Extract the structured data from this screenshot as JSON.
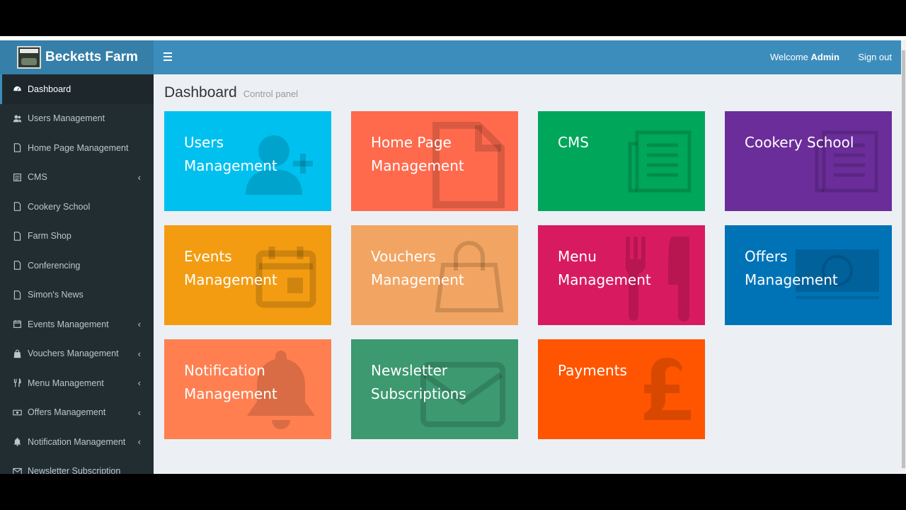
{
  "app": {
    "name": "Becketts Farm",
    "logo_icon": "farm-logo"
  },
  "header": {
    "welcome_prefix": "Welcome",
    "user": "Admin",
    "signout": "Sign out"
  },
  "sidebar": {
    "items": [
      {
        "label": "Dashboard",
        "icon": "dashboard-icon",
        "active": true,
        "submenu": false
      },
      {
        "label": "Users Management",
        "icon": "users-icon",
        "submenu": false
      },
      {
        "label": "Home Page Management",
        "icon": "file-icon",
        "submenu": false
      },
      {
        "label": "CMS",
        "icon": "list-icon",
        "submenu": true
      },
      {
        "label": "Cookery School",
        "icon": "file-icon",
        "submenu": false
      },
      {
        "label": "Farm Shop",
        "icon": "file-icon",
        "submenu": false
      },
      {
        "label": "Conferencing",
        "icon": "file-icon",
        "submenu": false
      },
      {
        "label": "Simon's News",
        "icon": "file-icon",
        "submenu": false
      },
      {
        "label": "Events Management",
        "icon": "calendar-icon",
        "submenu": true
      },
      {
        "label": "Vouchers Management",
        "icon": "shopping-bag-icon",
        "submenu": true
      },
      {
        "label": "Menu Management",
        "icon": "cutlery-icon",
        "submenu": true
      },
      {
        "label": "Offers Management",
        "icon": "money-icon",
        "submenu": true
      },
      {
        "label": "Notification Management",
        "icon": "bell-icon",
        "submenu": true
      },
      {
        "label": "Newsletter Subscription",
        "icon": "envelope-icon",
        "submenu": false
      }
    ],
    "chevron": "‹"
  },
  "main": {
    "title": "Dashboard",
    "subtitle": "Control panel",
    "tiles": [
      {
        "line1": "Users",
        "line2": "Management",
        "color": "#00c0ef",
        "icon": "user-plus-icon"
      },
      {
        "line1": "Home Page",
        "line2": "Management",
        "color": "#ff6a4d",
        "icon": "file-icon"
      },
      {
        "line1": "CMS",
        "line2": "",
        "color": "#00a65a",
        "icon": "newspaper-icon"
      },
      {
        "line1": "Cookery School",
        "line2": "",
        "color": "#6a2d9a",
        "icon": "newspaper-icon"
      },
      {
        "line1": "Events",
        "line2": "Management",
        "color": "#f39c12",
        "icon": "calendar-icon"
      },
      {
        "line1": "Vouchers",
        "line2": "Management",
        "color": "#f2a562",
        "icon": "shopping-bag-icon"
      },
      {
        "line1": "Menu",
        "line2": "Management",
        "color": "#d81b60",
        "icon": "cutlery-icon"
      },
      {
        "line1": "Offers",
        "line2": "Management",
        "color": "#0073b7",
        "icon": "money-icon"
      },
      {
        "line1": "Notification",
        "line2": "Management",
        "color": "#ff7f50",
        "icon": "bell-icon"
      },
      {
        "line1": "Newsletter",
        "line2": "Subscriptions",
        "color": "#3d9970",
        "icon": "envelope-icon"
      },
      {
        "line1": "Payments",
        "line2": "",
        "color": "#ff5500",
        "icon": "pound-icon"
      }
    ]
  }
}
